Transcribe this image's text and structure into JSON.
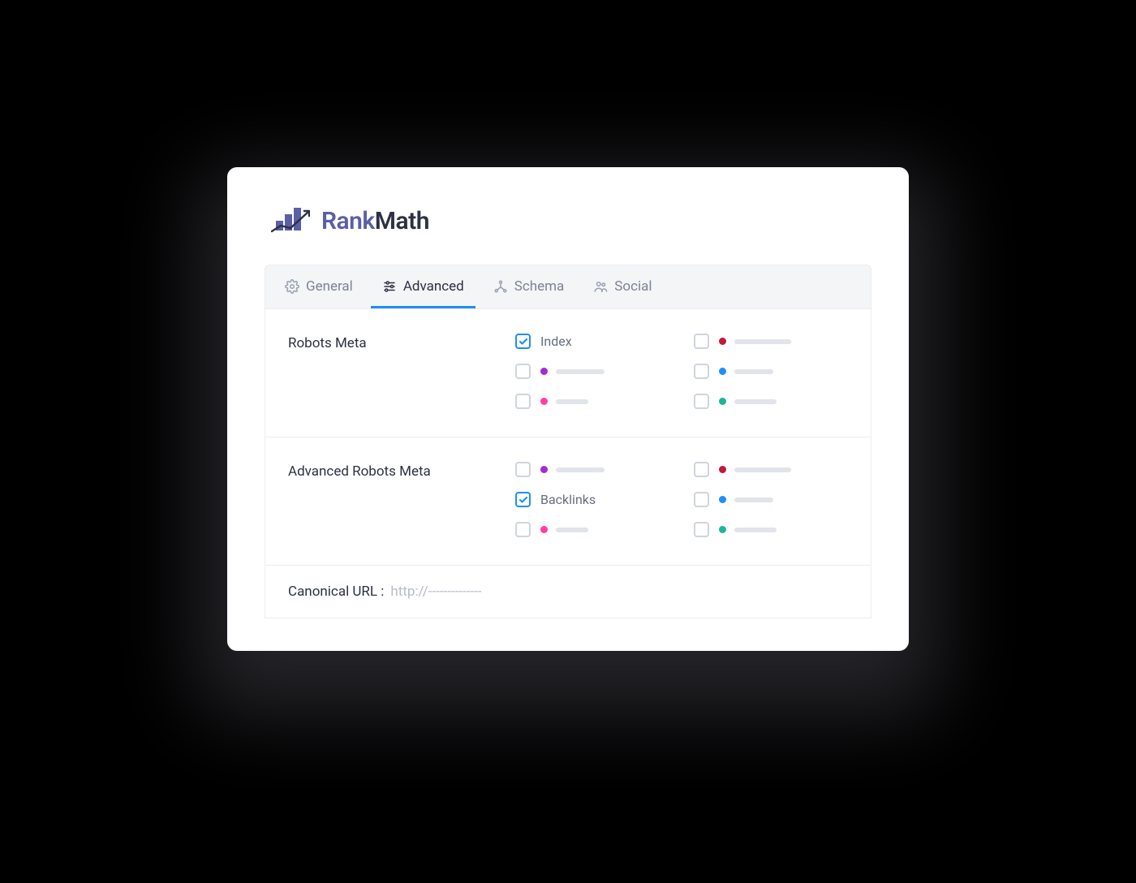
{
  "brand": {
    "first": "Rank",
    "second": "Math"
  },
  "tabs": [
    {
      "label": "General"
    },
    {
      "label": "Advanced"
    },
    {
      "label": "Schema"
    },
    {
      "label": "Social"
    }
  ],
  "sections": {
    "robots": {
      "title": "Robots Meta",
      "index_label": "Index"
    },
    "advanced_robots": {
      "title": "Advanced Robots Meta",
      "backlinks_label": "Backlinks"
    }
  },
  "canonical": {
    "label": "Canonical URL :",
    "placeholder": "http://--------------"
  },
  "colors": {
    "purple": "#a22bd6",
    "pink": "#ff3fa4",
    "red": "#c4183c",
    "blue": "#1f8efa",
    "teal": "#1fb596"
  }
}
